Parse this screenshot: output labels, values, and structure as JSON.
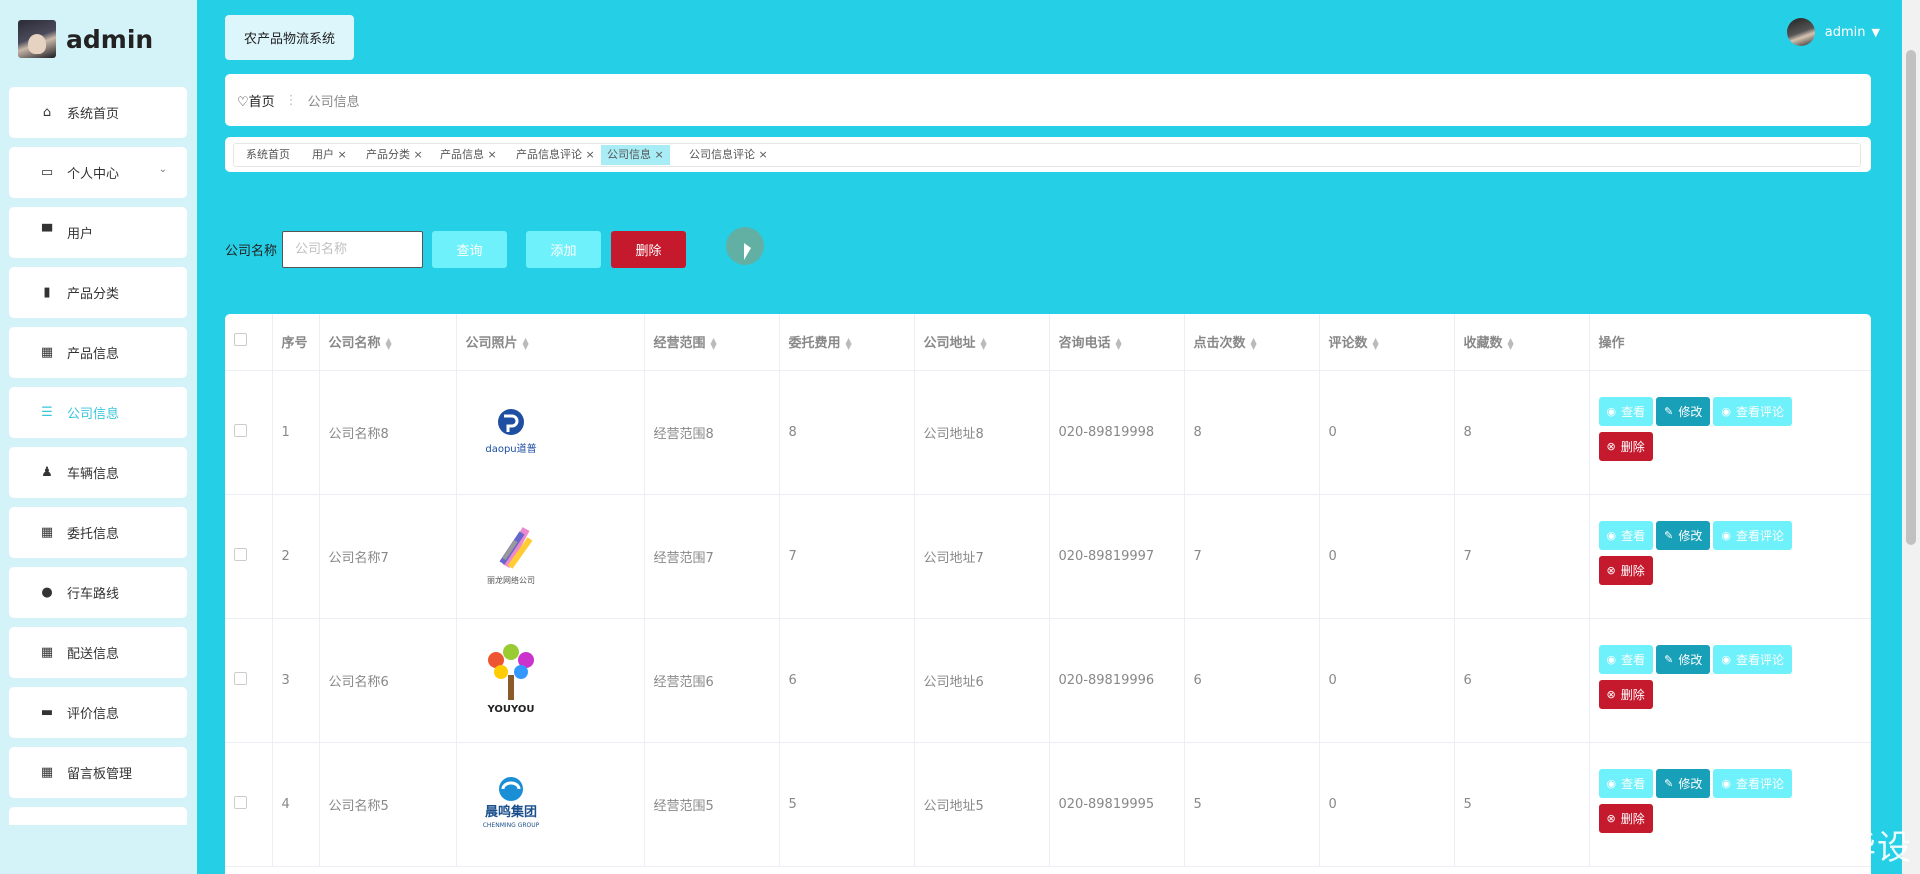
{
  "brand": {
    "name": "admin"
  },
  "sidebar": {
    "items": [
      {
        "label": "系统首页",
        "icon": "home-icon"
      },
      {
        "label": "个人中心",
        "icon": "calendar-icon",
        "expandable": true
      },
      {
        "label": "用户",
        "icon": "user-icon"
      },
      {
        "label": "产品分类",
        "icon": "bar-chart-icon"
      },
      {
        "label": "产品信息",
        "icon": "grid-icon"
      },
      {
        "label": "公司信息",
        "icon": "sliders-icon",
        "active": true
      },
      {
        "label": "车辆信息",
        "icon": "person-icon"
      },
      {
        "label": "委托信息",
        "icon": "grid-icon"
      },
      {
        "label": "行车路线",
        "icon": "location-icon"
      },
      {
        "label": "配送信息",
        "icon": "grid-icon"
      },
      {
        "label": "评价信息",
        "icon": "chat-icon"
      },
      {
        "label": "留言板管理",
        "icon": "grid-icon"
      }
    ]
  },
  "header": {
    "system_title": "农产品物流系统",
    "user_name": "admin"
  },
  "breadcrumb": {
    "home": "首页",
    "current": "公司信息"
  },
  "tags": [
    {
      "label": "系统首页",
      "closable": false
    },
    {
      "label": "用户",
      "closable": true
    },
    {
      "label": "产品分类",
      "closable": true
    },
    {
      "label": "产品信息",
      "closable": true
    },
    {
      "label": "产品信息评论",
      "closable": true
    },
    {
      "label": "公司信息",
      "closable": true,
      "active": true
    },
    {
      "label": "公司信息评论",
      "closable": true
    }
  ],
  "search": {
    "label": "公司名称",
    "placeholder": "公司名称",
    "query_label": "查询",
    "add_label": "添加",
    "delete_label": "删除"
  },
  "table": {
    "headers": [
      "序号",
      "公司名称",
      "公司照片",
      "经营范围",
      "委托费用",
      "公司地址",
      "咨询电话",
      "点击次数",
      "评论数",
      "收藏数",
      "操作"
    ],
    "ops": {
      "view": "查看",
      "edit": "修改",
      "comments": "查看评论",
      "delete": "删除"
    },
    "rows": [
      {
        "no": "1",
        "name": "公司名称8",
        "logo": "daopu",
        "logo_text": "daopu道普",
        "scope": "经营范围8",
        "fee": "8",
        "address": "公司地址8",
        "phone": "020-89819998",
        "clicks": "8",
        "comments": "0",
        "favorites": "8"
      },
      {
        "no": "2",
        "name": "公司名称7",
        "logo": "feather",
        "logo_text": "丽龙网络公司",
        "scope": "经营范围7",
        "fee": "7",
        "address": "公司地址7",
        "phone": "020-89819997",
        "clicks": "7",
        "comments": "0",
        "favorites": "7"
      },
      {
        "no": "3",
        "name": "公司名称6",
        "logo": "tree",
        "logo_text": "YOUYOU",
        "scope": "经营范围6",
        "fee": "6",
        "address": "公司地址6",
        "phone": "020-89819996",
        "clicks": "6",
        "comments": "0",
        "favorites": "6"
      },
      {
        "no": "4",
        "name": "公司名称5",
        "logo": "chenming",
        "logo_text": "晨鸣集团",
        "logo_subtext": "CHENMING GROUP",
        "scope": "经营范围5",
        "fee": "5",
        "address": "公司地址5",
        "phone": "020-89819995",
        "clicks": "5",
        "comments": "0",
        "favorites": "5"
      }
    ]
  },
  "watermark": "CSDN @米罗毕设",
  "colors": {
    "primary": "#25cfe6",
    "light_btn": "#6ff1fb",
    "edit_btn": "#17a0b8",
    "danger": "#c5192d",
    "sidebar_bg": "#d4f3f9"
  }
}
